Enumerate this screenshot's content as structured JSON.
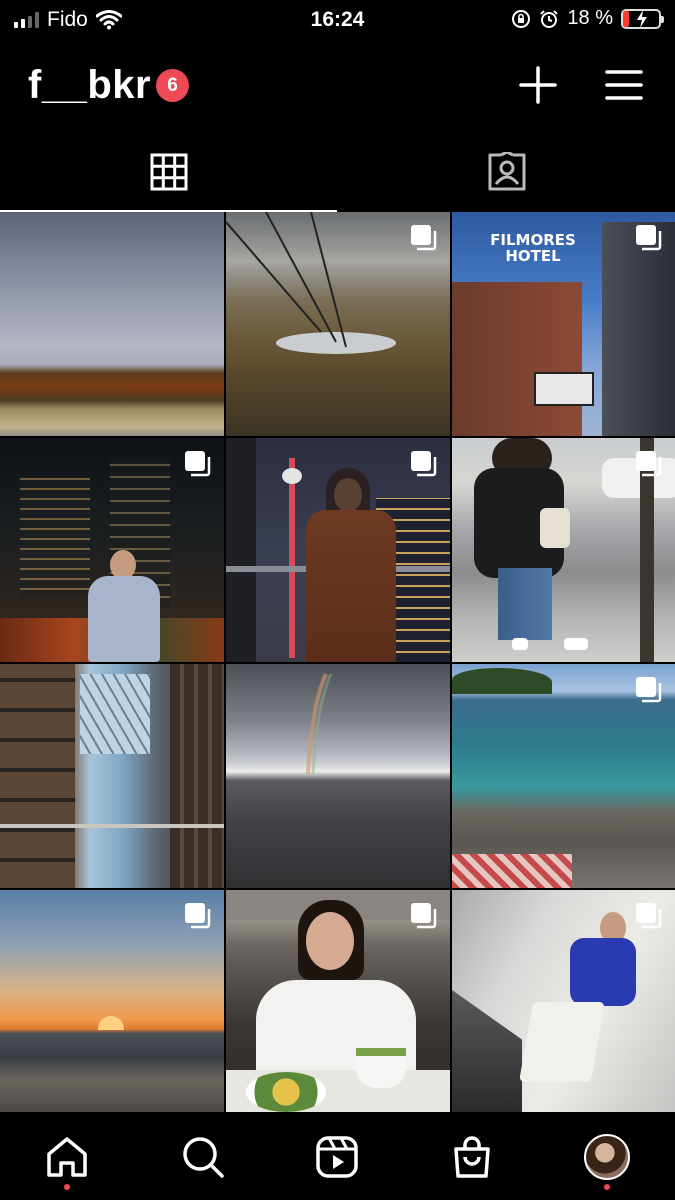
{
  "status_bar": {
    "carrier": "Fido",
    "time": "16:24",
    "battery_percent": "18 %",
    "battery_level": 0.18
  },
  "header": {
    "username": "f__bkr",
    "notification_count": "6",
    "icons": [
      "plus-icon",
      "menu-icon"
    ]
  },
  "tabs": [
    {
      "icon": "grid-icon",
      "active": true
    },
    {
      "icon": "tagged-icon",
      "active": false
    }
  ],
  "posts": [
    {
      "subject": "autumn field under cloudy sky",
      "multi": false
    },
    {
      "subject": "gondola cables over autumn valley and lake",
      "multi": true
    },
    {
      "subject": "Filmores Hotel sign",
      "multi": true
    },
    {
      "subject": "woman in light coat at night in city",
      "multi": true
    },
    {
      "subject": "woman in brown coat with CN Tower",
      "multi": true
    },
    {
      "subject": "mirror selfie in leather jacket",
      "multi": true
    },
    {
      "subject": "glass atrium between brick buildings",
      "multi": false
    },
    {
      "subject": "rainbow over grey lake",
      "multi": false
    },
    {
      "subject": "turquoise water and rocky shore",
      "multi": true
    },
    {
      "subject": "sunset over lake beach",
      "multi": true
    },
    {
      "subject": "woman in white shirt at restaurant",
      "multi": true
    },
    {
      "subject": "woman in blue t-shirt against white wall",
      "multi": true
    }
  ],
  "bottom_nav": {
    "items": [
      "home-icon",
      "search-icon",
      "reels-icon",
      "shop-icon",
      "profile-avatar"
    ],
    "active": "home-icon",
    "accent": "#ed4956"
  }
}
